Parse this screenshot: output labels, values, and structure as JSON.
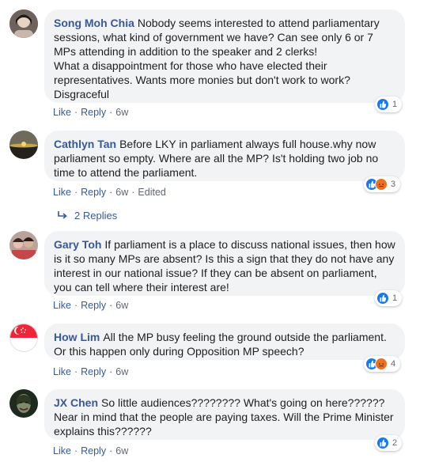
{
  "comments": [
    {
      "author": "Song Moh Chia",
      "text": "Nobody seems interested to attend parliamentary sessions, what kind of government we have? Can see only 6 or 7 MPs attending in addition to the speaker and 2 clerks!\nWhat a disappointment for those who have elected their representatives. Wants more monies but don't work to work? Disgraceful",
      "like_label": "Like",
      "reply_label": "Reply",
      "time": "6w",
      "reaction_count": "1"
    },
    {
      "author": "Cathlyn Tan",
      "text": "Before LKY in parliament always full house.why now parliament so empty. Where are all the MP? Is't holding two job no time to attend the parliament.",
      "like_label": "Like",
      "reply_label": "Reply",
      "time": "6w",
      "edited_label": "Edited",
      "reaction_count": "3",
      "replies_label": "2 Replies"
    },
    {
      "author": "Gary Toh",
      "text": "If parliament is a place to discuss national issues, then how is it so many MPs are absent? Is this a sign that they do not have any interest in our national issue? If they can be absent on parliament, you can tell where their interest are!",
      "like_label": "Like",
      "reply_label": "Reply",
      "time": "6w",
      "reaction_count": "1"
    },
    {
      "author": "How Lim",
      "text": "All the MP busy feeling the ground outside the parliament. Or this happen only during Opposition MP speech?",
      "like_label": "Like",
      "reply_label": "Reply",
      "time": "6w",
      "reaction_count": "4"
    },
    {
      "author": "JX Chen",
      "text": "So little audiences???????? What's going on here??????\nNear in mind that the people are paying taxes. Will the Prime Minister explains this??????",
      "like_label": "Like",
      "reply_label": "Reply",
      "time": "6w",
      "reaction_count": "2"
    }
  ],
  "colors": {
    "author": "#385898",
    "bubble": "#f2f3f5",
    "like": "#1877f2",
    "angry": "#f0701f"
  }
}
